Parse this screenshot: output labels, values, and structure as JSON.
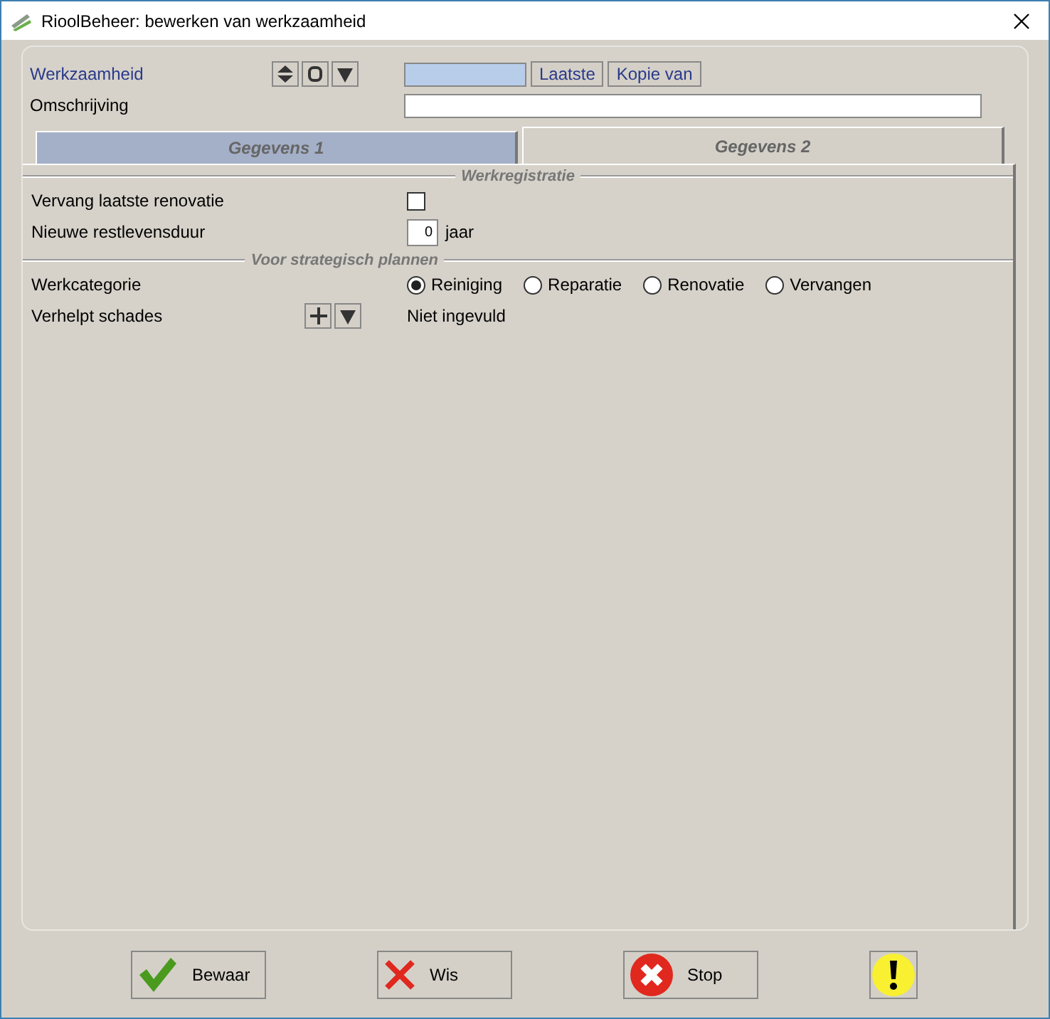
{
  "window": {
    "title": "RioolBeheer: bewerken van werkzaamheid"
  },
  "header": {
    "werkzaamheid_label": "Werkzaamheid",
    "omschrijving_label": "Omschrijving",
    "buttons": [
      {
        "label": "Laatste"
      },
      {
        "label": "Kopie van"
      }
    ]
  },
  "tabs": [
    {
      "label": "Gegevens 1",
      "selected": false
    },
    {
      "label": "Gegevens 2",
      "selected": true
    }
  ],
  "werkregistratie": {
    "title": "Werkregistratie",
    "vervang_label": "Vervang laatste renovatie",
    "vervang_checked": false,
    "restlevensduur_label": "Nieuwe restlevensduur",
    "restlevensduur_value": "0",
    "restlevensduur_unit": "jaar"
  },
  "strategisch": {
    "title": "Voor strategisch plannen",
    "werkcategorie_label": "Werkcategorie",
    "options": [
      {
        "label": "Reiniging",
        "selected": true
      },
      {
        "label": "Reparatie",
        "selected": false
      },
      {
        "label": "Renovatie",
        "selected": false
      },
      {
        "label": "Vervangen",
        "selected": false
      }
    ],
    "schades_label": "Verhelpt schades",
    "schades_value": "Niet ingevuld"
  },
  "footer": [
    {
      "kind": "save",
      "label": "Bewaar"
    },
    {
      "kind": "clear",
      "label": "Wis"
    },
    {
      "kind": "stop",
      "label": "Stop"
    },
    {
      "kind": "warning"
    }
  ]
}
